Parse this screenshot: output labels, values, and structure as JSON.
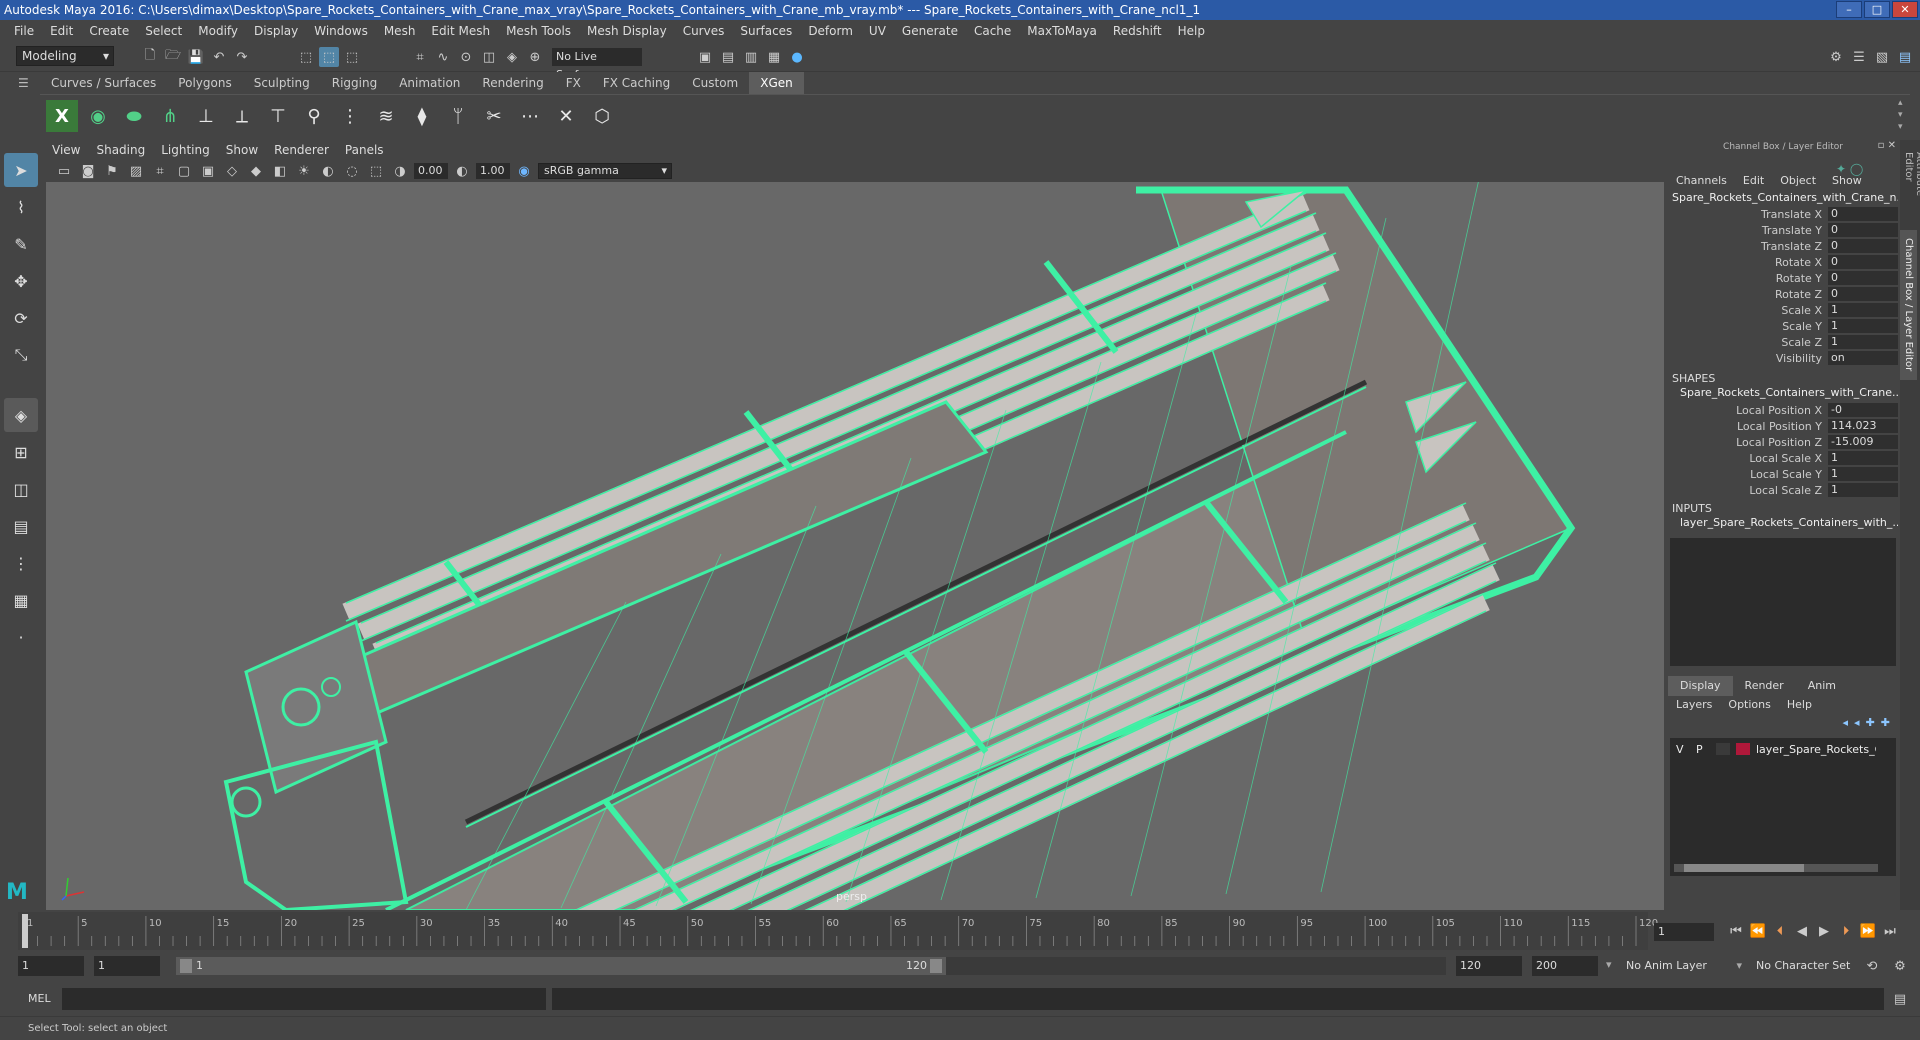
{
  "title": "Autodesk Maya 2016: C:\\Users\\dimax\\Desktop\\Spare_Rockets_Containers_with_Crane_max_vray\\Spare_Rockets_Containers_with_Crane_mb_vray.mb*  ---  Spare_Rockets_Containers_with_Crane_ncl1_1",
  "menus": [
    "File",
    "Edit",
    "Create",
    "Select",
    "Modify",
    "Display",
    "Windows",
    "Mesh",
    "Edit Mesh",
    "Mesh Tools",
    "Mesh Display",
    "Curves",
    "Surfaces",
    "Deform",
    "UV",
    "Generate",
    "Cache",
    "MaxToMaya",
    "Redshift",
    "Help"
  ],
  "mode": "Modeling",
  "live_surface": "No Live Surface",
  "shelf_tabs": [
    "Curves / Surfaces",
    "Polygons",
    "Sculpting",
    "Rigging",
    "Animation",
    "Rendering",
    "FX",
    "FX Caching",
    "Custom",
    "XGen"
  ],
  "active_shelf": "XGen",
  "panel_menus": [
    "View",
    "Shading",
    "Lighting",
    "Show",
    "Renderer",
    "Panels"
  ],
  "exposure": "0.00",
  "gamma": "1.00",
  "color_space": "sRGB gamma",
  "camera": "persp",
  "channel_box": {
    "header": "Channel Box / Layer Editor",
    "menus": [
      "Channels",
      "Edit",
      "Object",
      "Show"
    ],
    "object": "Spare_Rockets_Containers_with_Crane_n...",
    "attrs": [
      {
        "name": "Translate X",
        "value": "0"
      },
      {
        "name": "Translate Y",
        "value": "0"
      },
      {
        "name": "Translate Z",
        "value": "0"
      },
      {
        "name": "Rotate X",
        "value": "0"
      },
      {
        "name": "Rotate Y",
        "value": "0"
      },
      {
        "name": "Rotate Z",
        "value": "0"
      },
      {
        "name": "Scale X",
        "value": "1"
      },
      {
        "name": "Scale Y",
        "value": "1"
      },
      {
        "name": "Scale Z",
        "value": "1"
      },
      {
        "name": "Visibility",
        "value": "on"
      }
    ],
    "shapes_label": "SHAPES",
    "shape_name": "Spare_Rockets_Containers_with_Crane...",
    "shape_attrs": [
      {
        "name": "Local Position X",
        "value": "-0"
      },
      {
        "name": "Local Position Y",
        "value": "114.023"
      },
      {
        "name": "Local Position Z",
        "value": "-15.009"
      },
      {
        "name": "Local Scale X",
        "value": "1"
      },
      {
        "name": "Local Scale Y",
        "value": "1"
      },
      {
        "name": "Local Scale Z",
        "value": "1"
      }
    ],
    "inputs_label": "INPUTS",
    "input_name": "layer_Spare_Rockets_Containers_with_..."
  },
  "layer_editor": {
    "tabs": [
      "Display",
      "Render",
      "Anim"
    ],
    "menus": [
      "Layers",
      "Options",
      "Help"
    ],
    "layer": {
      "v": "V",
      "p": "P",
      "name": "layer_Spare_Rockets_Cor",
      "color": "#b0183a"
    }
  },
  "side_tabs": [
    "Attribute Editor",
    "Channel Box / Layer Editor"
  ],
  "timeline": {
    "ticks": [
      "1",
      "5",
      "10",
      "15",
      "20",
      "25",
      "30",
      "35",
      "40",
      "45",
      "50",
      "55",
      "60",
      "65",
      "70",
      "75",
      "80",
      "85",
      "90",
      "95",
      "100",
      "105",
      "110",
      "115",
      "120"
    ],
    "current_frame": "1"
  },
  "range": {
    "start": "1",
    "playback_start": "1",
    "slider_start": "1",
    "slider_end": "120",
    "playback_end": "120",
    "end": "200",
    "anim_layer": "No Anim Layer",
    "char_set": "No Character Set"
  },
  "cmd_label": "MEL",
  "help_text": "Select Tool: select an object",
  "wire_color": "#3ef0a4"
}
